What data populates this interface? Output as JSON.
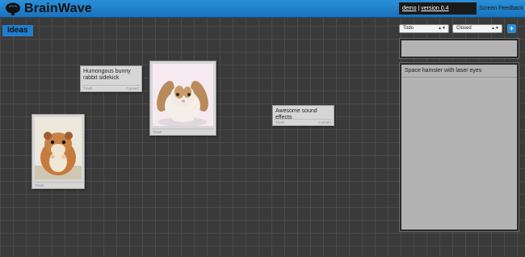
{
  "app": {
    "title": "BrainWave"
  },
  "header": {
    "user_link": "demo",
    "separator": " | ",
    "version_link": "version 0.4",
    "feedback_label": "Screen Feedback"
  },
  "board": {
    "tab_label": "Ideas",
    "cards": [
      {
        "text": "Humongous bunny rabbit sidekick",
        "trash": "Trash",
        "convert": "Convert"
      },
      {
        "text": "Awesome sound effects",
        "trash": "Trash",
        "convert": "Convert"
      }
    ],
    "photo_cards": [
      {
        "subject": "bunny",
        "trash": "Trash"
      },
      {
        "subject": "hamster",
        "trash": "Trash"
      }
    ]
  },
  "sidebar": {
    "filter_status": {
      "selected": "Todo"
    },
    "filter_state": {
      "selected": "Closed"
    },
    "add_label": "+",
    "items": [
      {
        "text": "Space hamster with laser eyes"
      }
    ]
  },
  "colors": {
    "accent": "#2a8fd8",
    "background": "#3a3a3a",
    "card": "#d6d6d6",
    "panel": "#b3b3b3"
  }
}
